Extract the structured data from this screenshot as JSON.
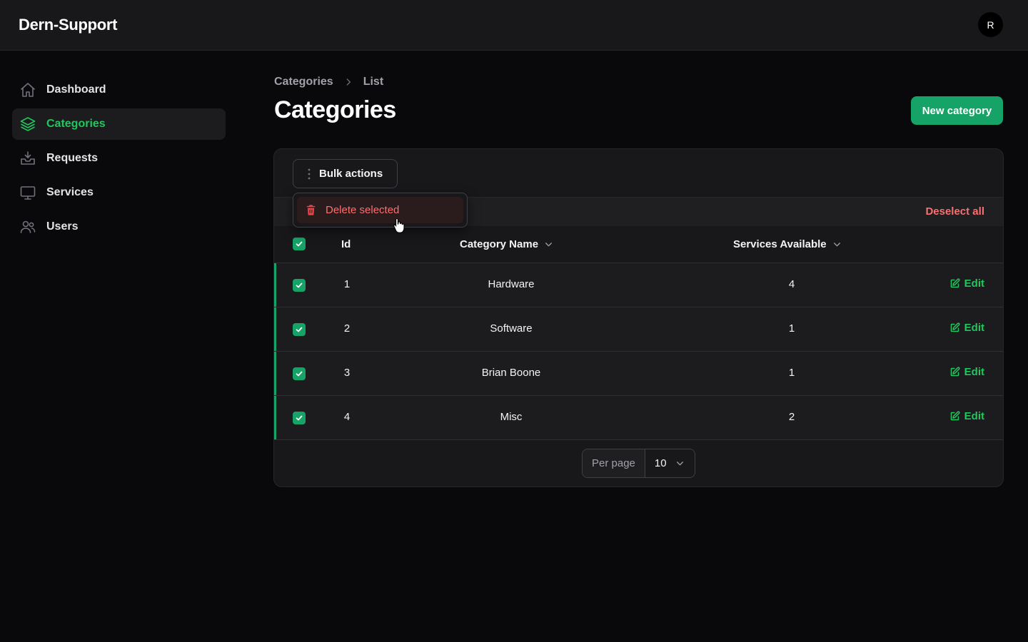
{
  "app": {
    "brand": "Dern-Support",
    "user_initial": "R"
  },
  "sidebar": {
    "items": [
      {
        "label": "Dashboard",
        "icon": "home-icon",
        "active": false
      },
      {
        "label": "Categories",
        "icon": "layers-icon",
        "active": true
      },
      {
        "label": "Requests",
        "icon": "inbox-icon",
        "active": false
      },
      {
        "label": "Services",
        "icon": "monitor-icon",
        "active": false
      },
      {
        "label": "Users",
        "icon": "users-icon",
        "active": false
      }
    ]
  },
  "header": {
    "breadcrumb": [
      "Categories",
      "List"
    ],
    "title": "Categories",
    "new_button": "New category"
  },
  "table": {
    "bulk_actions_label": "Bulk actions",
    "deselect_label": "Deselect all",
    "columns": {
      "id": "Id",
      "name": "Category Name",
      "services": "Services Available"
    },
    "edit_label": "Edit",
    "rows": [
      {
        "id": "1",
        "name": "Hardware",
        "services": "4",
        "selected": true
      },
      {
        "id": "2",
        "name": "Software",
        "services": "1",
        "selected": true
      },
      {
        "id": "3",
        "name": "Brian Boone",
        "services": "1",
        "selected": true
      },
      {
        "id": "4",
        "name": "Misc",
        "services": "2",
        "selected": true
      }
    ]
  },
  "pagination": {
    "per_page_label": "Per page",
    "per_page_value": "10"
  },
  "bulk_menu": {
    "items": [
      {
        "label": "Delete selected",
        "icon": "trash-icon"
      }
    ]
  },
  "colors": {
    "accent": "#16a367",
    "accent_text": "#22c55e",
    "danger": "#f87171",
    "background": "#09090b",
    "surface": "#18181b"
  }
}
